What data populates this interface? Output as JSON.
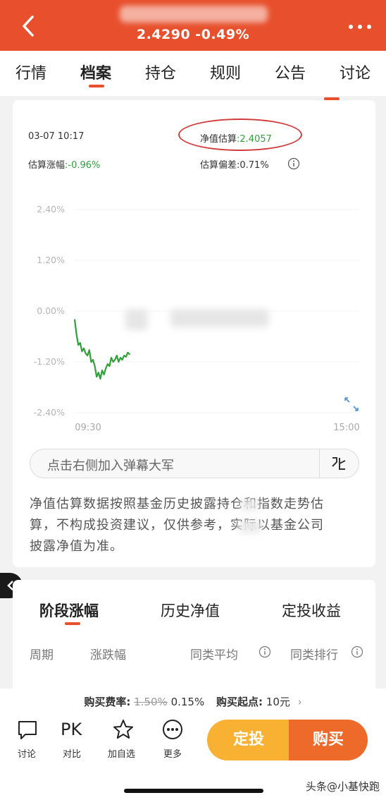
{
  "header": {
    "subtitle": "2.4290 -0.49%",
    "accent_color": "#e8502d",
    "back_icon": "back-chevron-icon",
    "more_icon": "more-dots-icon"
  },
  "tabs": [
    {
      "label": "行情"
    },
    {
      "label": "档案",
      "active": true
    },
    {
      "label": "持仓"
    },
    {
      "label": "规则"
    },
    {
      "label": "公告"
    },
    {
      "label": "讨论"
    }
  ],
  "estimate": {
    "time": "03-07 10:17",
    "nav_label": "净值估算",
    "nav_value": ":2.4057",
    "change_label": "估算涨幅",
    "change_value": ":-0.96%",
    "deviation": "估算偏差:0.71%",
    "green_color": "#2fa03a"
  },
  "chart_data": {
    "type": "line",
    "y_ticks": [
      "2.40%",
      "1.20%",
      "0.00%",
      "-1.20%",
      "-2.40%"
    ],
    "x_ticks": [
      "09:30",
      "15:00"
    ],
    "ylim": [
      -2.4,
      2.4
    ],
    "series": [
      {
        "values": [
          -0.2,
          -0.55,
          -0.8,
          -0.75,
          -0.95,
          -0.88,
          -1.0,
          -1.05,
          -0.92,
          -1.2,
          -1.15,
          -1.3,
          -1.55,
          -1.45,
          -1.6,
          -1.4,
          -1.5,
          -1.35,
          -1.25,
          -1.3,
          -1.1,
          -1.2,
          -1.15,
          -1.05,
          -1.2,
          -1.1,
          -1.15,
          -1.05,
          -1.08,
          -0.98,
          -1.02
        ]
      }
    ],
    "line_color": "#2fa03a"
  },
  "danmu": {
    "placeholder": "点击右侧加入弹幕大军"
  },
  "disclaimer": {
    "line1": "净值估算数据按照基金历史披露持仓和指数走势估",
    "line2": "算，不构成投资建议，仅供参考，实际以基金公司",
    "line3": "披露净值为准。"
  },
  "subtabs": [
    {
      "label": "阶段涨幅",
      "active": true
    },
    {
      "label": "历史净值"
    },
    {
      "label": "定投收益"
    }
  ],
  "columns": [
    "周期",
    "涨跌幅",
    "同类平均",
    "同类排行"
  ],
  "fee": {
    "fee_label": "购买费率:",
    "old_fee": "1.50%",
    "new_fee": "0.15%",
    "start_label": "购买起点:",
    "start_value": "10元"
  },
  "bottom_bar": [
    {
      "label": "讨论",
      "icon": "comment-icon"
    },
    {
      "label": "对比",
      "icon_text": "PK"
    },
    {
      "label": "加自选",
      "icon": "star-icon"
    },
    {
      "label": "更多",
      "icon": "more-icon"
    }
  ],
  "buttons": {
    "dingtou": "定投",
    "buy": "购买"
  },
  "watermark": "头条@小基快跑"
}
